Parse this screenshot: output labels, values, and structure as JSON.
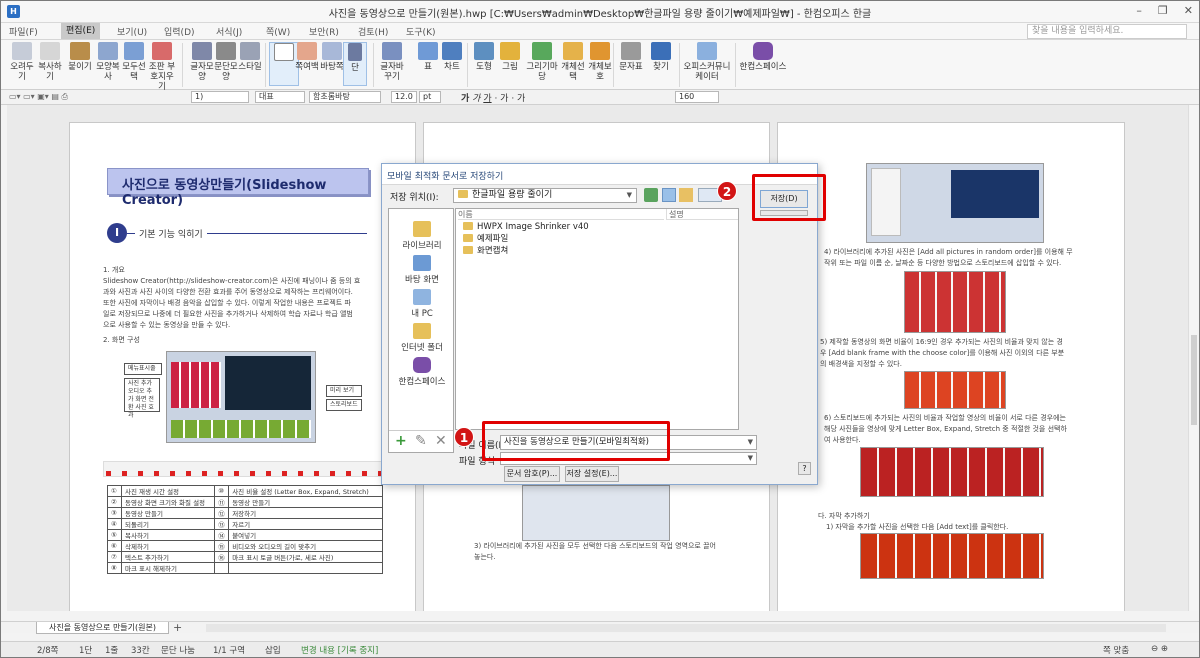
{
  "window": {
    "title": "사진을 동영상으로 만들기(원본).hwp [C:₩Users₩admin₩Desktop₩한글파일 용량 줄이기₩예제파일₩] - 한컴오피스 한글"
  },
  "menubar": {
    "items": [
      "파일(F)",
      "편집(E)",
      "보기(U)",
      "입력(D)",
      "서식(J)",
      "쪽(W)",
      "보안(R)",
      "검토(H)",
      "도구(K)"
    ],
    "search_placeholder": "찾을 내용을 입력하세요."
  },
  "ribbon": {
    "buttons": [
      "오려두기",
      "복사하기",
      "붙이기",
      "모양복사",
      "모두선택",
      "조판 부호지우기",
      "글자모양",
      "문단모양",
      "스타일",
      "",
      "쪽여백",
      "바탕쪽",
      "단",
      "글자바꾸기",
      "표",
      "차트",
      "도형",
      "그림",
      "그리기마당",
      "개체선택",
      "개체보호",
      "문자표",
      "찾기",
      "오피스커뮤니케이터",
      "한컴스페이스"
    ]
  },
  "format_bar": {
    "style": "1)",
    "font_lang": "대표",
    "font": "함초롬바탕",
    "size": "12.0",
    "unit": "pt",
    "zoom": "160"
  },
  "page1": {
    "title_text": "사진으로 동영상만들기(Slideshow Creator)",
    "section_number": "I",
    "section_label": "기본 기능 익히기",
    "overview_heading": "1. 개요",
    "overview_lines": [
      "Slideshow Creator(http://slideshow-creator.com)은 사진에 패닝이나 줌 등의 효",
      "과와 사진과 사진 사이의 다양한 전환 효과를 주어 동영상으로 제작하는 프리웨어이다.",
      "또한 사진에 자막이나 배경 음악을 삽입할 수 있다. 이렇게 작업한 내용은 프로젝트 파",
      "일로 저장되므로 나중에 더 필요한 사진을 추가하거나 삭제하여 학습 자료나 학급 앨범",
      "으로 사용할 수 있는 동영상을 만들 수 있다."
    ],
    "screen_heading": "2. 화면 구성",
    "callouts": [
      "메뉴표시줄",
      "사진 추가 오디오 추가 화면 전환 사진 효과",
      "미리 보기",
      "스토리보드"
    ],
    "table_rows": [
      [
        "①",
        "사진 재생 시간 설정",
        "⑩",
        "사진 비율 설정 (Letter Box, Expand, Stretch)"
      ],
      [
        "②",
        "동영상 화면 크기와 화질 설정",
        "⑪",
        "동영상 만들기"
      ],
      [
        "③",
        "동영상 만들기",
        "⑫",
        "저장하기"
      ],
      [
        "④",
        "되돌리기",
        "⑬",
        "자르기"
      ],
      [
        "⑤",
        "복사하기",
        "⑭",
        "붙여넣기"
      ],
      [
        "⑥",
        "삭제하기",
        "⑮",
        "비디오와 오디오의 길이 맞추기"
      ],
      [
        "⑦",
        "텍스트 추가하기",
        "⑯",
        "마크 표시 토글 버튼(가로, 세로 사진)"
      ],
      [
        "⑧",
        "마크 표시 해제하기",
        "",
        ""
      ]
    ]
  },
  "page2": {
    "caption_lines": [
      "3) 라이브러리에 추가된 사진을 모두 선택한 다음 스토리보드의 작업 영역으로 끌어",
      "놓는다."
    ]
  },
  "page3": {
    "p4_lines": [
      "4) 라이브러리에 추가된 사진은 [Add all pictures in random order]를 이용해 무",
      "작위 또는 파일 이름 순, 날짜순 등 다양한 방법으로 스토리보드에 삽입할 수 있다."
    ],
    "p5_lines": [
      "5) 제작할 동영상의 화면 비율이 16:9인 경우 추가되는 사진의 비율과 맞지 않는 경",
      "우 [Add blank frame with the choose color]를 이용해 사진 이외의 다른 부분",
      "의 배경색을 지정할 수 있다."
    ],
    "p6_lines": [
      "6) 스토리보드에 추가되는 사진의 비율과 작업할 영상의 비율이 서로 다른 경우에는",
      "해당 사진들을 영상에 맞게 Letter Box, Expand, Stretch 중 적절한 것을 선택하",
      "여 사용한다."
    ],
    "heading_d": "다. 자막 추가하기",
    "p7_line": "1) 자막을 추가할 사진을 선택한 다음 [Add text]를 클릭한다."
  },
  "dialog": {
    "title": "모바일 최적화 문서로 저장하기",
    "location_label": "저장 위치(I):",
    "location_value": "한글파일 용량 줄이기",
    "places": [
      "라이브러리",
      "바탕 화면",
      "내 PC",
      "인터넷 폴더",
      "한컴스페이스"
    ],
    "col_name": "이름",
    "col_desc": "설명",
    "files": [
      "HWPX Image Shrinker v40",
      "예제파일",
      "화면캡쳐"
    ],
    "filename_label": "파일 이름(N):",
    "filename_value": "사진을 동영상으로 만들기(모바일최적화)",
    "filetype_label": "파일 형식",
    "save_button": "저장(D)",
    "password_button": "문서 암호(P)...",
    "save_settings_button": "저장 설정(E)...",
    "help": "?"
  },
  "annotations": {
    "badge1": "1",
    "badge2": "2"
  },
  "doc_tab": {
    "label": "사진을 동영상으로 만들기(원본)",
    "add": "+"
  },
  "statusbar": {
    "items": [
      "2/8쪽",
      "1단",
      "1줄",
      "33칸",
      "문단 나눔",
      "1/1 구역",
      "삽입",
      "변경 내용 [기록 중지]"
    ],
    "zoom_mode": "쪽 맞춤"
  }
}
